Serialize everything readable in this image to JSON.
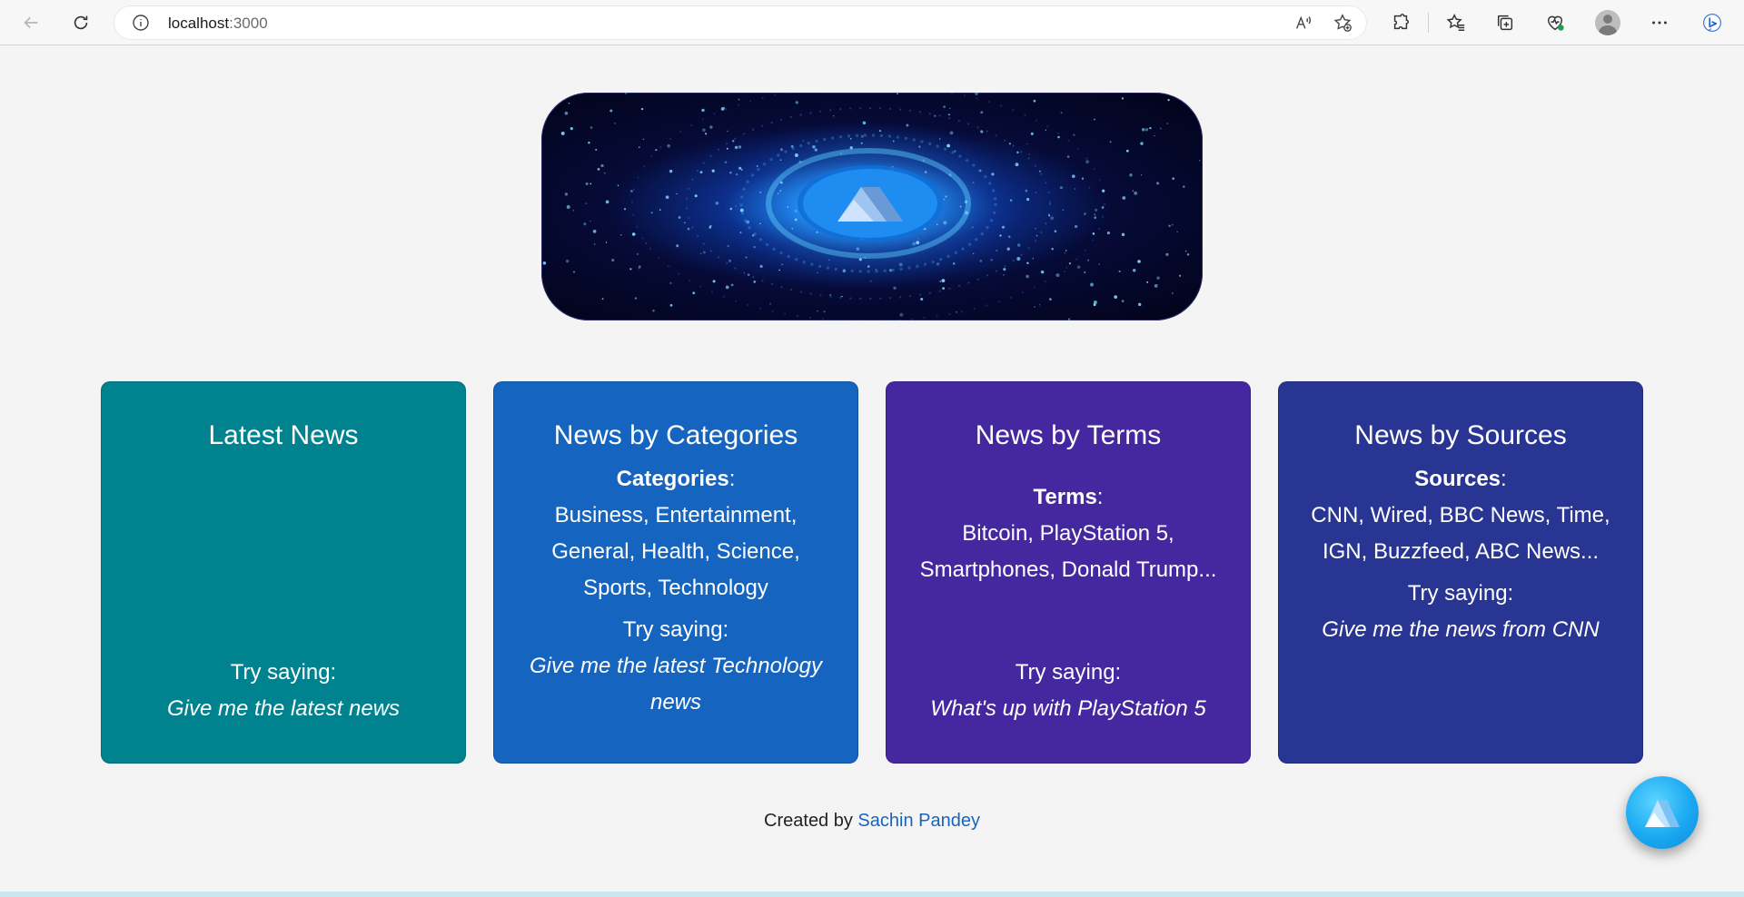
{
  "browser": {
    "url_host": "localhost",
    "url_port": ":3000"
  },
  "hero": {
    "image_name": "alan-ai-galaxy-banner"
  },
  "cards": [
    {
      "title": "Latest News",
      "try_label": "Try saying:",
      "try_example": "Give me the latest news",
      "color": "#00838f"
    },
    {
      "title": "News by Categories",
      "list_label": "Categories",
      "list_suffix": ":",
      "list_text": "Business, Entertainment, General, Health, Science, Sports, Technology",
      "try_label": "Try saying:",
      "try_example": "Give me the latest Technology news",
      "color": "#1565c0"
    },
    {
      "title": "News by Terms",
      "list_label": "Terms",
      "list_suffix": ":",
      "list_text": "Bitcoin, PlayStation 5, Smartphones, Donald Trump...",
      "try_label": "Try saying:",
      "try_example": "What's up with PlayStation 5",
      "color": "#4527a0"
    },
    {
      "title": "News by Sources",
      "list_label": "Sources",
      "list_suffix": ":",
      "list_text": "CNN, Wired, BBC News, Time, IGN, Buzzfeed, ABC News...",
      "try_label": "Try saying:",
      "try_example": "Give me the news from CNN",
      "color": "#283593"
    }
  ],
  "footer": {
    "prefix": "Created by ",
    "author": "Sachin Pandey"
  },
  "icons": {
    "back": "back-arrow-icon",
    "refresh": "refresh-icon",
    "info": "info-icon",
    "read_aloud": "read-aloud-icon",
    "add_favorite": "add-favorite-icon",
    "extensions": "extensions-icon",
    "favorites": "favorites-icon",
    "collections": "collections-icon",
    "browser_essentials": "browser-essentials-icon",
    "profile": "profile-icon",
    "more": "more-icon",
    "copilot": "copilot-icon",
    "assistant": "alan-assistant-icon"
  }
}
